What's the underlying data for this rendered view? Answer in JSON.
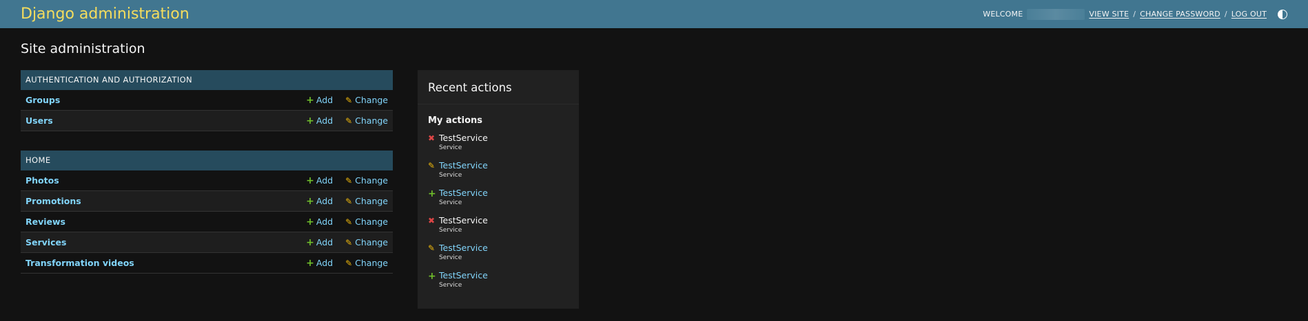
{
  "header": {
    "branding": "Django administration",
    "welcome": "WELCOME",
    "view_site": "VIEW SITE",
    "change_password": "CHANGE PASSWORD",
    "log_out": "LOG OUT",
    "separator": "/"
  },
  "page_title": "Site administration",
  "modules": [
    {
      "caption": "AUTHENTICATION AND AUTHORIZATION",
      "models": [
        {
          "name": "Groups",
          "add": "Add",
          "change": "Change"
        },
        {
          "name": "Users",
          "add": "Add",
          "change": "Change"
        }
      ]
    },
    {
      "caption": "HOME",
      "models": [
        {
          "name": "Photos",
          "add": "Add",
          "change": "Change"
        },
        {
          "name": "Promotions",
          "add": "Add",
          "change": "Change"
        },
        {
          "name": "Reviews",
          "add": "Add",
          "change": "Change"
        },
        {
          "name": "Services",
          "add": "Add",
          "change": "Change"
        },
        {
          "name": "Transformation videos",
          "add": "Add",
          "change": "Change"
        }
      ]
    }
  ],
  "recent_actions": {
    "title": "Recent actions",
    "subtitle": "My actions",
    "items": [
      {
        "action": "deletion",
        "icon": "delete-icon",
        "object": "TestService",
        "type": "Service"
      },
      {
        "action": "change",
        "icon": "pencil-icon",
        "object": "TestService",
        "type": "Service"
      },
      {
        "action": "addition",
        "icon": "plus-icon",
        "object": "TestService",
        "type": "Service"
      },
      {
        "action": "deletion",
        "icon": "delete-icon",
        "object": "TestService",
        "type": "Service"
      },
      {
        "action": "change",
        "icon": "pencil-icon",
        "object": "TestService",
        "type": "Service"
      },
      {
        "action": "addition",
        "icon": "plus-icon",
        "object": "TestService",
        "type": "Service"
      }
    ]
  },
  "colors": {
    "header_bg": "#417690",
    "caption_bg": "#264b5d",
    "link": "#81d4fa",
    "add_icon": "#70bf2b",
    "change_icon": "#efb80b",
    "delete_icon": "#dd4646"
  }
}
